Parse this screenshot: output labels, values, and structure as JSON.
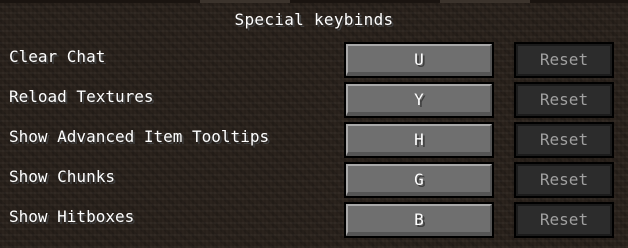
{
  "heading": "Special keybinds",
  "keybinds": [
    {
      "label": "Clear Chat",
      "key": "U",
      "reset": "Reset"
    },
    {
      "label": "Reload Textures",
      "key": "Y",
      "reset": "Reset"
    },
    {
      "label": "Show Advanced Item Tooltips",
      "key": "H",
      "reset": "Reset"
    },
    {
      "label": "Show Chunks",
      "key": "G",
      "reset": "Reset"
    },
    {
      "label": "Show Hitboxes",
      "key": "B",
      "reset": "Reset"
    }
  ]
}
